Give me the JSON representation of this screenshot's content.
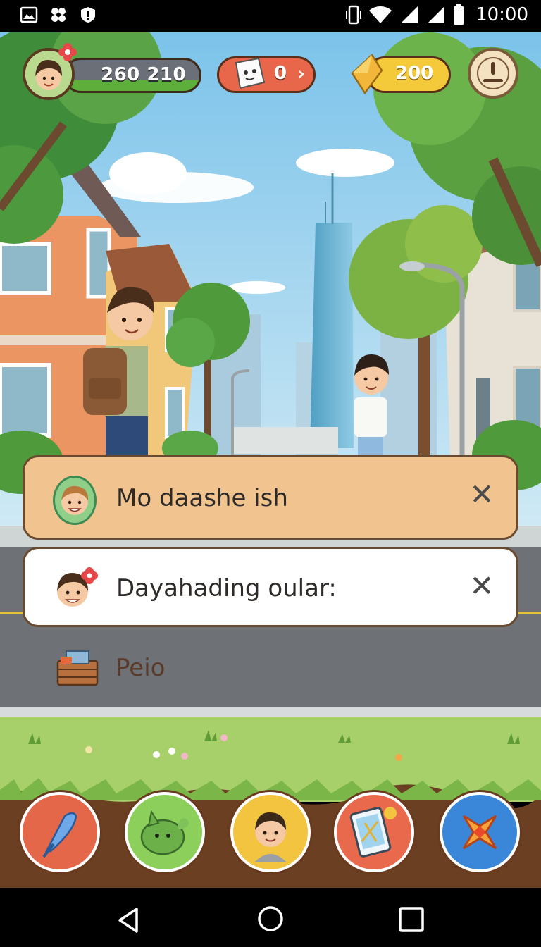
{
  "status_bar": {
    "time": "10:00",
    "left_icons": [
      "image-icon",
      "pinwheel-icon",
      "shield-icon"
    ],
    "right_icons": [
      "vibrate-icon",
      "wifi-icon",
      "signal-icon",
      "signal-icon",
      "battery-icon"
    ]
  },
  "hud": {
    "xp_text": "260 210",
    "cards_count": "0",
    "gold_count": "200",
    "colors": {
      "xp_bar": "#5dae3b",
      "cards": "#e8674b",
      "gold": "#f4c93a"
    }
  },
  "dialog": {
    "line1": "Mo daashe ish",
    "line2": "Dayahading oular:",
    "item_label": "Peio"
  },
  "bottom_bar": {
    "buttons": [
      "feather-icon",
      "creature-icon",
      "character-icon",
      "tablet-icon",
      "star-icon"
    ],
    "colors": [
      "#e4674a",
      "#8ccf5a",
      "#f3c440",
      "#e9694d",
      "#3a86d8"
    ]
  },
  "nav_bar": {
    "buttons": [
      "back-icon",
      "home-icon",
      "recents-icon"
    ]
  }
}
